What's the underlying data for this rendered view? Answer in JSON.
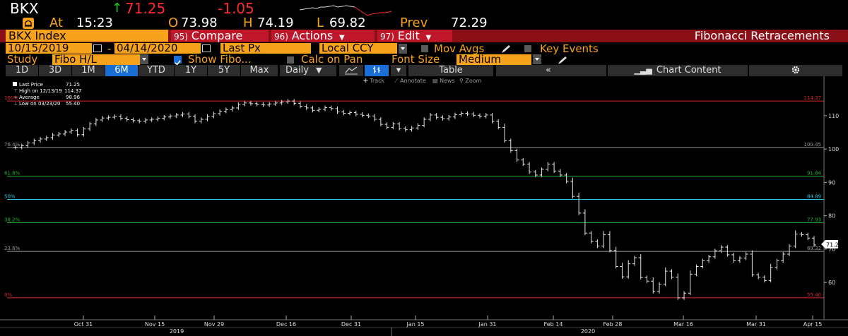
{
  "quote": {
    "ticker": "BKX",
    "arrow": "↑",
    "price": "71.25",
    "change": "-1.05",
    "at_label": "At",
    "time": "15:23",
    "open_label": "O",
    "open": "73.98",
    "high_label": "H",
    "high": "74.19",
    "low_label": "L",
    "low": "69.82",
    "prev_label": "Prev",
    "prev": "72.29"
  },
  "toolbar": {
    "index_name": "BKX Index",
    "compare_num": "95)",
    "compare_label": "Compare",
    "actions_num": "96)",
    "actions_label": "Actions",
    "edit_num": "97)",
    "edit_label": "Edit",
    "study_title": "Fibonacci Retracements"
  },
  "settings": {
    "date_from": "10/15/2019",
    "date_sep": "-",
    "date_to": "04/14/2020",
    "field": "Last Px",
    "currency": "Local CCY",
    "mov_avgs": "Mov Avgs",
    "key_events": "Key Events",
    "study_label": "Study",
    "study_value": "Fibo H/L",
    "show_fibo": "Show Fibo...",
    "calc_on_pan": "Calc on Pan",
    "font_size_label": "Font Size",
    "font_size_value": "Medium"
  },
  "tabs": [
    "1D",
    "3D",
    "1M",
    "6M",
    "YTD",
    "1Y",
    "5Y",
    "Max"
  ],
  "active_tab": "6M",
  "period": "Daily",
  "table_label": "Table",
  "chart_content_label": "Chart Content",
  "tools": {
    "track": "Track",
    "annotate": "Annotate",
    "news": "News",
    "zoom": "Zoom"
  },
  "legend": {
    "last_price_label": "Last Price",
    "last_price_value": "71.25",
    "high_label": "High on 12/13/19",
    "high_value": "114.37",
    "average_label": "Average",
    "average_value": "98.96",
    "low_label": "Low on 03/23/20",
    "low_value": "55.40"
  },
  "fib_levels": [
    {
      "pct": "100%",
      "value": "114.37",
      "color": "#d8252b"
    },
    {
      "pct": "76.4%",
      "value": "100.45",
      "color": "#9a9a9a"
    },
    {
      "pct": "61.8%",
      "value": "91.84",
      "color": "#23b233"
    },
    {
      "pct": "50%",
      "value": "84.89",
      "color": "#2bc7e0"
    },
    {
      "pct": "38.2%",
      "value": "77.93",
      "color": "#23b233"
    },
    {
      "pct": "23.6%",
      "value": "69.32",
      "color": "#9a9a9a"
    },
    {
      "pct": "0%",
      "value": "55.40",
      "color": "#d8252b"
    }
  ],
  "last_price_tag": "71.25",
  "chart_data": {
    "type": "line",
    "yticks": [
      "110",
      "100",
      "90",
      "80",
      "70",
      "60"
    ],
    "ylim": [
      52,
      118
    ],
    "xticks": [
      "Oct 31",
      "Nov 15",
      "Nov 29",
      "Dec 16",
      "Dec 31",
      "Jan 15",
      "Jan 31",
      "Feb 14",
      "Feb 28",
      "Mar 16",
      "Mar 31",
      "Apr 15"
    ],
    "year_labels": [
      "2019",
      "2020"
    ],
    "series": [
      {
        "values": [
          100.5,
          101,
          101.8,
          102.5,
          103,
          103.4,
          104.2,
          104.5,
          105.1,
          105.6,
          104.3,
          106,
          107.5,
          108.7,
          109.3,
          109.5,
          109.8,
          109.2,
          108.8,
          108.5,
          108.3,
          108.7,
          108.9,
          109.2,
          109.6,
          109.9,
          110.2,
          110.5,
          109.8,
          108.3,
          108.9,
          109.8,
          110.6,
          111.3,
          111.8,
          112.3,
          113.4,
          113.8,
          113.6,
          113.4,
          113.2,
          113.5,
          113.8,
          114.1,
          114.37,
          113.7,
          112.8,
          112.3,
          111.6,
          111.9,
          112.4,
          112.1,
          111.1,
          110.7,
          110.9,
          110.4,
          110.1,
          109.9,
          108.9,
          107.4,
          106.5,
          107.5,
          106.2,
          105.8,
          106.3,
          107.1,
          108.9,
          110.2,
          109.5,
          109.1,
          109.6,
          110.3,
          110.7,
          110.5,
          110.1,
          109.8,
          110.2,
          108.3,
          106.5,
          102.5,
          99.5,
          96.7,
          95.5,
          93.1,
          92.2,
          93.9,
          95.5,
          93.4,
          92.2,
          90.3,
          85.8,
          80.8,
          74.8,
          72.3,
          70.9,
          74.3,
          69.6,
          64.8,
          61.7,
          65.6,
          67.4,
          61.5,
          60.4,
          57.3,
          59.5,
          63.4,
          61.6,
          55.4,
          56.8,
          62.5,
          64.8,
          66.5,
          67.7,
          69.5,
          70.6,
          68.3,
          66.5,
          67.3,
          68.5,
          62.3,
          61.6,
          60.6,
          64.5,
          66.5,
          68.5,
          70.9,
          74.5,
          74.3,
          73.3,
          71.25
        ]
      }
    ]
  }
}
